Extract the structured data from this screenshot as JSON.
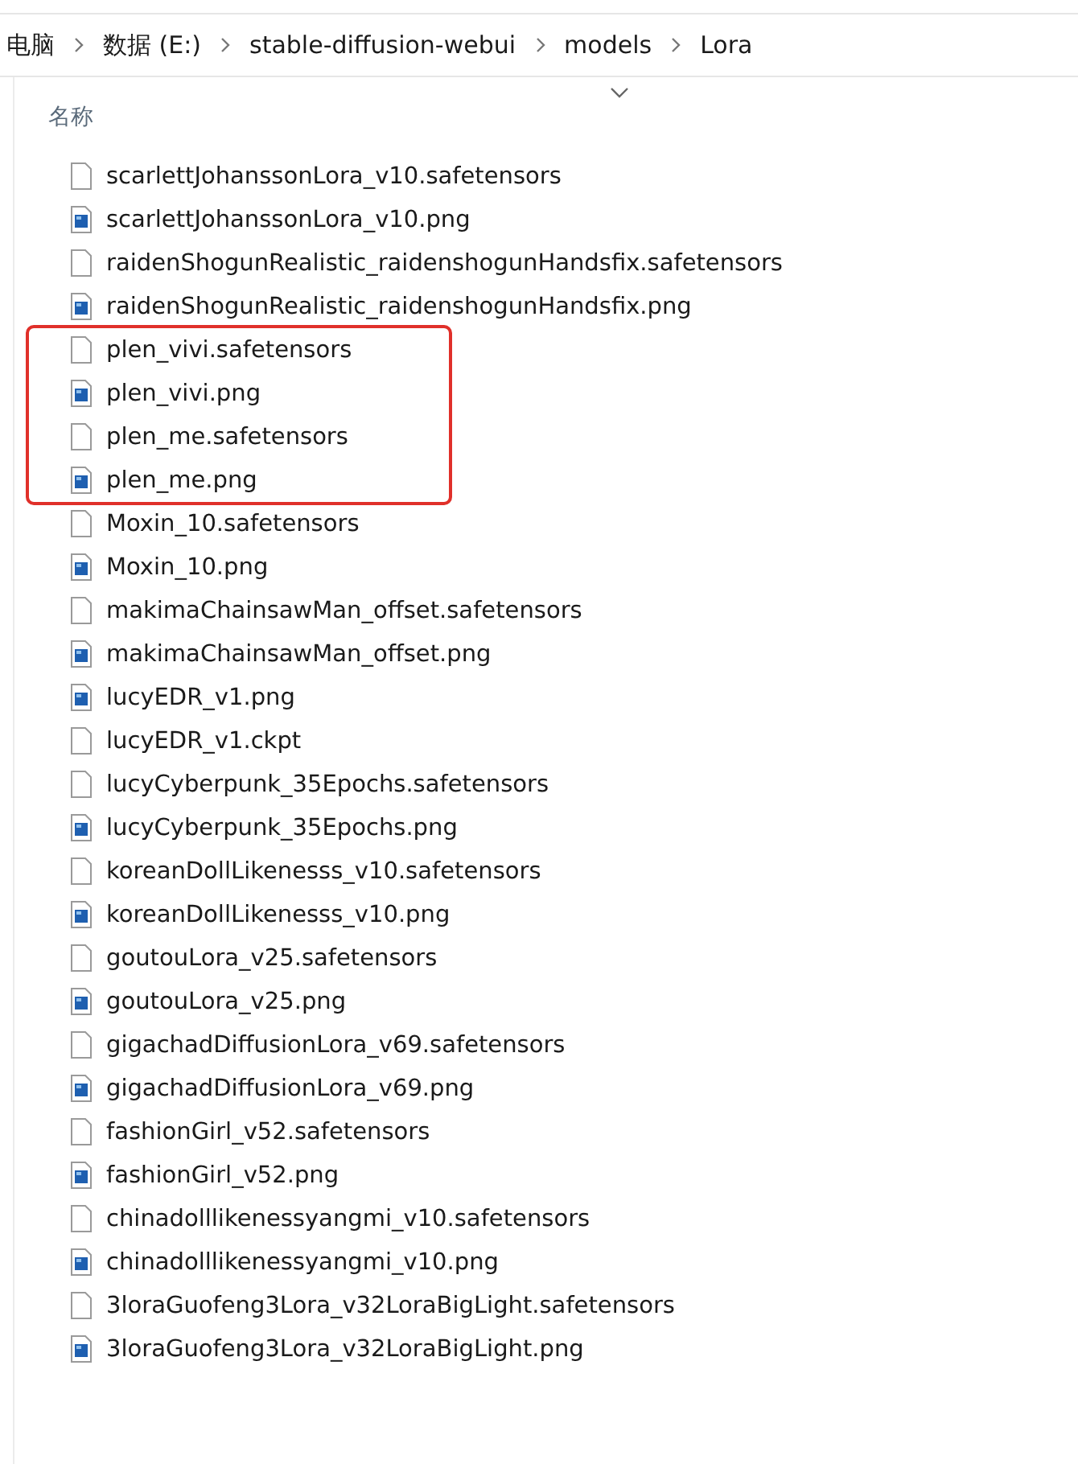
{
  "breadcrumb": [
    {
      "label": "电脑"
    },
    {
      "label": "数据 (E:)"
    },
    {
      "label": "stable-diffusion-webui"
    },
    {
      "label": "models"
    },
    {
      "label": "Lora"
    }
  ],
  "column_header": {
    "label": "名称"
  },
  "files": [
    {
      "name": "scarlettJohanssonLora_v10.safetensors",
      "kind": "file",
      "highlighted": false
    },
    {
      "name": "scarlettJohanssonLora_v10.png",
      "kind": "image",
      "highlighted": false
    },
    {
      "name": "raidenShogunRealistic_raidenshogunHandsfix.safetensors",
      "kind": "file",
      "highlighted": false
    },
    {
      "name": "raidenShogunRealistic_raidenshogunHandsfix.png",
      "kind": "image",
      "highlighted": false
    },
    {
      "name": "plen_vivi.safetensors",
      "kind": "file",
      "highlighted": true
    },
    {
      "name": "plen_vivi.png",
      "kind": "image",
      "highlighted": true
    },
    {
      "name": "plen_me.safetensors",
      "kind": "file",
      "highlighted": true
    },
    {
      "name": "plen_me.png",
      "kind": "image",
      "highlighted": true
    },
    {
      "name": "Moxin_10.safetensors",
      "kind": "file",
      "highlighted": false
    },
    {
      "name": "Moxin_10.png",
      "kind": "image",
      "highlighted": false
    },
    {
      "name": "makimaChainsawMan_offset.safetensors",
      "kind": "file",
      "highlighted": false
    },
    {
      "name": "makimaChainsawMan_offset.png",
      "kind": "image",
      "highlighted": false
    },
    {
      "name": "lucyEDR_v1.png",
      "kind": "image",
      "highlighted": false
    },
    {
      "name": "lucyEDR_v1.ckpt",
      "kind": "file",
      "highlighted": false
    },
    {
      "name": "lucyCyberpunk_35Epochs.safetensors",
      "kind": "file",
      "highlighted": false
    },
    {
      "name": "lucyCyberpunk_35Epochs.png",
      "kind": "image",
      "highlighted": false
    },
    {
      "name": "koreanDollLikenesss_v10.safetensors",
      "kind": "file",
      "highlighted": false
    },
    {
      "name": "koreanDollLikenesss_v10.png",
      "kind": "image",
      "highlighted": false
    },
    {
      "name": "goutouLora_v25.safetensors",
      "kind": "file",
      "highlighted": false
    },
    {
      "name": "goutouLora_v25.png",
      "kind": "image",
      "highlighted": false
    },
    {
      "name": "gigachadDiffusionLora_v69.safetensors",
      "kind": "file",
      "highlighted": false
    },
    {
      "name": "gigachadDiffusionLora_v69.png",
      "kind": "image",
      "highlighted": false
    },
    {
      "name": "fashionGirl_v52.safetensors",
      "kind": "file",
      "highlighted": false
    },
    {
      "name": "fashionGirl_v52.png",
      "kind": "image",
      "highlighted": false
    },
    {
      "name": "chinadolllikenessyangmi_v10.safetensors",
      "kind": "file",
      "highlighted": false
    },
    {
      "name": "chinadolllikenessyangmi_v10.png",
      "kind": "image",
      "highlighted": false
    },
    {
      "name": "3loraGuofeng3Lora_v32LoraBigLight.safetensors",
      "kind": "file",
      "highlighted": false
    },
    {
      "name": "3loraGuofeng3Lora_v32LoraBigLight.png",
      "kind": "image",
      "highlighted": false
    }
  ]
}
